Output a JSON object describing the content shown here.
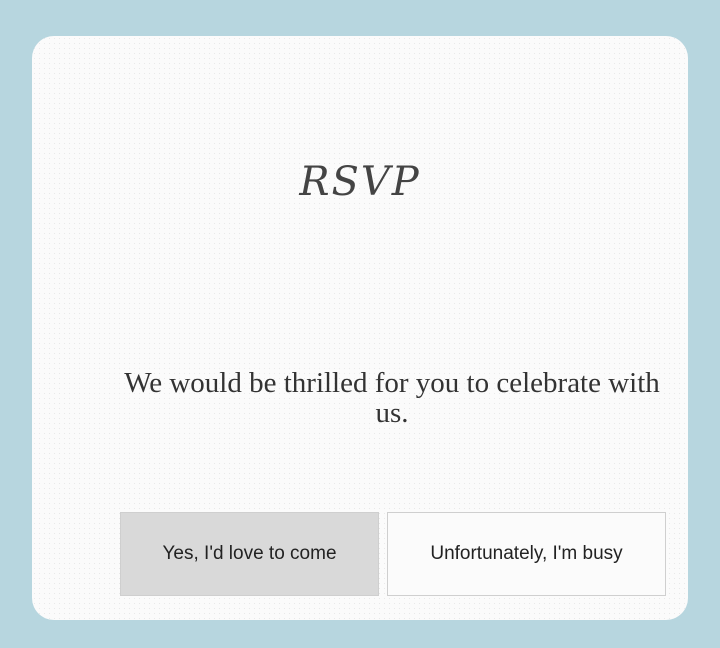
{
  "rsvp": {
    "title": "RSVP",
    "message": "We would be thrilled for you to celebrate with us.",
    "accept_label": "Yes, I'd love to come",
    "decline_label": "Unfortunately, I'm busy"
  },
  "colors": {
    "page_background": "#b7d6df",
    "card_background": "#fbfbfb",
    "selected_button": "#d9d9d9"
  }
}
